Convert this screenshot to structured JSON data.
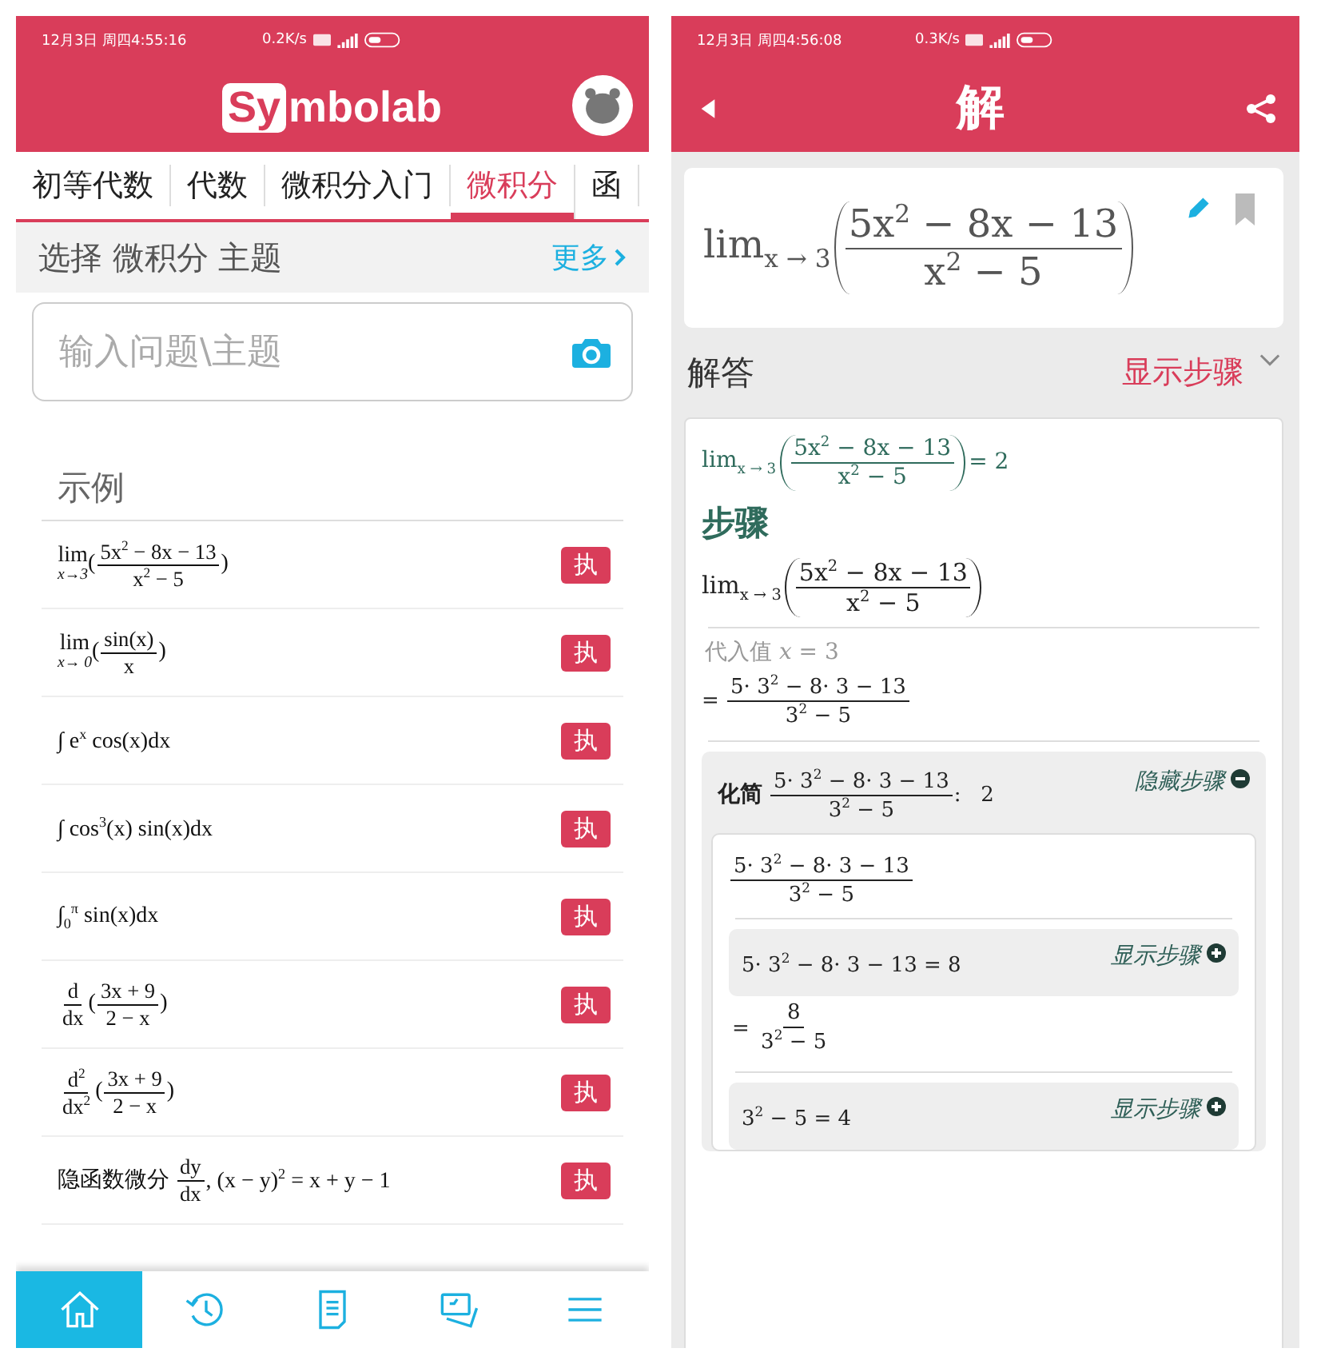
{
  "left": {
    "status": {
      "time": "12月3日 周四4:55:16",
      "speed": "0.2K/s"
    },
    "logo": {
      "boxed": "Sy",
      "rest": "mbolab"
    },
    "tabs": [
      {
        "label": "初等代数",
        "selected": false
      },
      {
        "label": "代数",
        "selected": false
      },
      {
        "label": "微积分入门",
        "selected": false
      },
      {
        "label": "微积分",
        "selected": true
      },
      {
        "label": "函",
        "selected": false
      }
    ],
    "topic_bar": {
      "title": "选择 微积分 主题",
      "more": "更多"
    },
    "search": {
      "placeholder": "输入问题\\主题"
    },
    "examples": {
      "heading": "示例",
      "rows": [
        {
          "expr": [
            {
              "kind": "lim",
              "text": "lim",
              "sub": "x→3"
            },
            {
              "kind": "t",
              "text": "("
            },
            {
              "kind": "frac",
              "num": "5x$^{2}$ − 8x − 13",
              "den": "x$^{2}$ − 5"
            },
            {
              "kind": "t",
              "text": ")"
            }
          ],
          "button": "执"
        },
        {
          "expr": [
            {
              "kind": "lim",
              "text": "lim",
              "sub": "x→ 0"
            },
            {
              "kind": "t",
              "text": "("
            },
            {
              "kind": "frac",
              "num": "sin(x)",
              "den": "x"
            },
            {
              "kind": "t",
              "text": ")"
            }
          ],
          "button": "执"
        },
        {
          "expr": [
            {
              "kind": "t",
              "text": "∫ e$^{x}$ cos(x)dx"
            }
          ],
          "button": "执"
        },
        {
          "expr": [
            {
              "kind": "t",
              "text": "∫ cos$^{3}$(x) sin(x)dx"
            }
          ],
          "button": "执"
        },
        {
          "expr": [
            {
              "kind": "t",
              "text": "∫$_{0}$$^{π}$ sin(x)dx"
            }
          ],
          "button": "执"
        },
        {
          "expr": [
            {
              "kind": "frac",
              "num": "d",
              "den": "dx"
            },
            {
              "kind": "t",
              "text": "("
            },
            {
              "kind": "frac",
              "num": "3x + 9",
              "den": "2 − x"
            },
            {
              "kind": "t",
              "text": ")"
            }
          ],
          "button": "执"
        },
        {
          "expr": [
            {
              "kind": "frac",
              "num": "d$^{2}$",
              "den": "dx$^{2}$"
            },
            {
              "kind": "t",
              "text": "("
            },
            {
              "kind": "frac",
              "num": "3x + 9",
              "den": "2 − x"
            },
            {
              "kind": "t",
              "text": ")"
            }
          ],
          "button": "执"
        },
        {
          "expr": [
            {
              "kind": "t",
              "text": "隐函数微分 "
            },
            {
              "kind": "frac",
              "num": "dy",
              "den": "dx"
            },
            {
              "kind": "t",
              "text": ", (x − y)$^{2}$ = x + y − 1"
            }
          ],
          "button": "执"
        }
      ]
    },
    "nav": [
      {
        "kind": "home",
        "selected": true
      },
      {
        "kind": "history",
        "selected": false
      },
      {
        "kind": "notes",
        "selected": false
      },
      {
        "kind": "cards",
        "selected": false
      },
      {
        "kind": "menu",
        "selected": false
      }
    ]
  },
  "right": {
    "status": {
      "time": "12月3日 周四4:56:08",
      "speed": "0.3K/s"
    },
    "title": "解",
    "problem": {
      "expr": [
        {
          "kind": "t",
          "text": "lim$_{x → 3}$"
        },
        {
          "kind": "paren",
          "body": [
            {
              "kind": "frac",
              "num": "5x$^{2}$ − 8x − 13",
              "den": "x$^{2}$ − 5"
            }
          ]
        }
      ]
    },
    "answer": {
      "label": "解答",
      "toggle": "显示步骤"
    },
    "result": {
      "expr": [
        {
          "kind": "t",
          "text": "lim$_{x → 3}$"
        },
        {
          "kind": "paren",
          "body": [
            {
              "kind": "frac",
              "num": "5x$^{2}$ − 8x − 13",
              "den": "x$^{2}$ − 5"
            }
          ]
        },
        {
          "kind": "t",
          "text": "= 2"
        }
      ]
    },
    "steps": {
      "heading": "步骤",
      "expr": [
        {
          "kind": "t",
          "text": "lim$_{x → 3}$"
        },
        {
          "kind": "paren",
          "body": [
            {
              "kind": "frac",
              "num": "5x$^{2}$ − 8x − 13",
              "den": "x$^{2}$ − 5"
            }
          ]
        }
      ],
      "substitute": {
        "label": "代入值 *x* = 3",
        "expr": [
          {
            "kind": "t",
            "text": "= "
          },
          {
            "kind": "frac",
            "num": "5· 3$^{2}$ − 8· 3 − 13",
            "den": "3$^{2}$ − 5"
          }
        ]
      },
      "simplify": {
        "label": "化简",
        "expr": [
          {
            "kind": "frac",
            "num": "5· 3$^{2}$ − 8· 3 − 13",
            "den": "3$^{2}$ − 5"
          },
          {
            "kind": "t",
            "text": ":   2"
          }
        ],
        "toggle": "隐藏步骤",
        "expanded": true,
        "body": {
          "expr": [
            {
              "kind": "frac",
              "num": "5· 3$^{2}$ − 8· 3 − 13",
              "den": "3$^{2}$ − 5"
            }
          ],
          "items": [
            {
              "kind": "step",
              "expr": [
                {
                  "kind": "t",
                  "text": "5· 3$^{2}$ − 8· 3 − 13 = 8"
                }
              ],
              "toggle": "显示步骤",
              "expanded": false
            },
            {
              "kind": "eq",
              "expr": [
                {
                  "kind": "t",
                  "text": "= "
                },
                {
                  "kind": "frac",
                  "num": "8",
                  "den": "3$^{2}$ − 5"
                }
              ]
            },
            {
              "kind": "step",
              "expr": [
                {
                  "kind": "t",
                  "text": "3$^{2}$ − 5 = 4"
                }
              ],
              "toggle": "显示步骤",
              "expanded": false
            }
          ]
        }
      }
    }
  }
}
